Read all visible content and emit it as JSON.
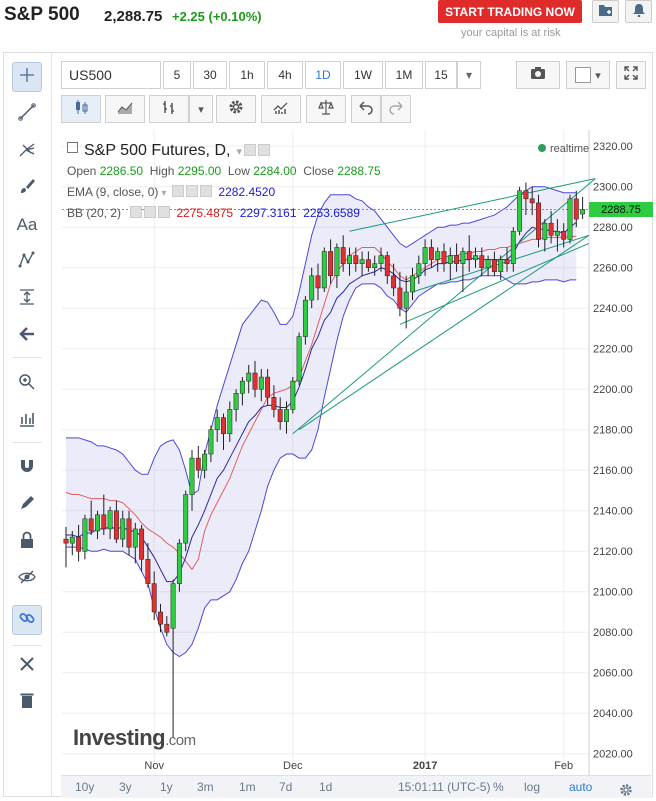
{
  "header": {
    "title": "S&P 500",
    "price": "2,288.75",
    "change": "+2.25 (+0.10%)",
    "start_button": "START TRADING NOW",
    "risk_note": "your capital is at risk"
  },
  "toolbar": {
    "symbol": "US500",
    "intervals": [
      "5",
      "30",
      "1h",
      "4h",
      "1D",
      "1W",
      "1M",
      "15"
    ],
    "selected_interval": "1D"
  },
  "legend": {
    "title": "S&P 500 Futures, D,",
    "realtime": "realtime",
    "ohlc_labels": {
      "open": "Open",
      "high": "High",
      "low": "Low",
      "close": "Close"
    },
    "ohlc_values": {
      "open": "2286.50",
      "high": "2295.00",
      "low": "2284.00",
      "close": "2288.75"
    },
    "ema_label": "EMA (9, close, 0)",
    "ema_value": "2282.4520",
    "bb_label": "BB (20, 2)",
    "bb_values": [
      "2275.4875",
      "2297.3161",
      "2253.6589"
    ]
  },
  "price_tag": "2288.75",
  "watermark": "Investing",
  "watermark_suffix": ".com",
  "bottom": {
    "ranges": [
      "10y",
      "3y",
      "1y",
      "3m",
      "1m",
      "7d",
      "1d"
    ],
    "time": "15:01:11 (UTC-5)",
    "pct": "%",
    "log": "log",
    "auto": "auto"
  },
  "colors": {
    "up": "#2ecc40",
    "down": "#e03030",
    "band": "#4a4ad8",
    "ema": "#2a2aa0",
    "mid": "#e06060",
    "trend": "#1a9a7a"
  },
  "chart_data": {
    "type": "candlestick",
    "title": "S&P 500 Futures, D",
    "y_ticks": [
      2020,
      2040,
      2060,
      2080,
      2100,
      2120,
      2140,
      2160,
      2180,
      2200,
      2220,
      2240,
      2260,
      2280,
      2300,
      2320
    ],
    "y_tick_labels": [
      "2020.00",
      "2040.00",
      "2060.00",
      "2080.00",
      "2100.00",
      "2120.00",
      "2140.00",
      "2160.00",
      "2180.00",
      "2200.00",
      "2220.00",
      "2240.00",
      "2260.00",
      "2280.00",
      "2300.00",
      "2320.00"
    ],
    "ylim": [
      2010,
      2328
    ],
    "x_ticks": [
      {
        "label": "Nov",
        "index": 14
      },
      {
        "label": "Dec",
        "index": 36
      },
      {
        "label": "2017",
        "index": 57
      },
      {
        "label": "Feb",
        "index": 79
      }
    ],
    "candles": [
      {
        "o": 2126,
        "h": 2132,
        "l": 2112,
        "c": 2124
      },
      {
        "o": 2124,
        "h": 2130,
        "l": 2118,
        "c": 2127
      },
      {
        "o": 2127,
        "h": 2133,
        "l": 2115,
        "c": 2120
      },
      {
        "o": 2120,
        "h": 2138,
        "l": 2116,
        "c": 2136
      },
      {
        "o": 2136,
        "h": 2145,
        "l": 2128,
        "c": 2130
      },
      {
        "o": 2130,
        "h": 2140,
        "l": 2126,
        "c": 2138
      },
      {
        "o": 2138,
        "h": 2148,
        "l": 2128,
        "c": 2131
      },
      {
        "o": 2131,
        "h": 2142,
        "l": 2126,
        "c": 2140
      },
      {
        "o": 2140,
        "h": 2145,
        "l": 2124,
        "c": 2126
      },
      {
        "o": 2126,
        "h": 2140,
        "l": 2122,
        "c": 2136
      },
      {
        "o": 2136,
        "h": 2140,
        "l": 2118,
        "c": 2122
      },
      {
        "o": 2122,
        "h": 2134,
        "l": 2114,
        "c": 2131
      },
      {
        "o": 2131,
        "h": 2133,
        "l": 2110,
        "c": 2116
      },
      {
        "o": 2116,
        "h": 2124,
        "l": 2102,
        "c": 2104
      },
      {
        "o": 2104,
        "h": 2110,
        "l": 2086,
        "c": 2090
      },
      {
        "o": 2090,
        "h": 2094,
        "l": 2080,
        "c": 2084
      },
      {
        "o": 2084,
        "h": 2088,
        "l": 2078,
        "c": 2080
      },
      {
        "o": 2082,
        "h": 2106,
        "l": 2028,
        "c": 2104
      },
      {
        "o": 2104,
        "h": 2126,
        "l": 2100,
        "c": 2124
      },
      {
        "o": 2124,
        "h": 2150,
        "l": 2120,
        "c": 2148
      },
      {
        "o": 2148,
        "h": 2170,
        "l": 2140,
        "c": 2166
      },
      {
        "o": 2166,
        "h": 2172,
        "l": 2156,
        "c": 2160
      },
      {
        "o": 2160,
        "h": 2170,
        "l": 2156,
        "c": 2168
      },
      {
        "o": 2168,
        "h": 2182,
        "l": 2164,
        "c": 2180
      },
      {
        "o": 2180,
        "h": 2190,
        "l": 2174,
        "c": 2186
      },
      {
        "o": 2186,
        "h": 2188,
        "l": 2170,
        "c": 2178
      },
      {
        "o": 2178,
        "h": 2194,
        "l": 2174,
        "c": 2190
      },
      {
        "o": 2190,
        "h": 2200,
        "l": 2184,
        "c": 2198
      },
      {
        "o": 2198,
        "h": 2206,
        "l": 2192,
        "c": 2204
      },
      {
        "o": 2204,
        "h": 2212,
        "l": 2198,
        "c": 2208
      },
      {
        "o": 2208,
        "h": 2214,
        "l": 2196,
        "c": 2200
      },
      {
        "o": 2200,
        "h": 2210,
        "l": 2194,
        "c": 2206
      },
      {
        "o": 2206,
        "h": 2210,
        "l": 2192,
        "c": 2196
      },
      {
        "o": 2196,
        "h": 2202,
        "l": 2186,
        "c": 2190
      },
      {
        "o": 2190,
        "h": 2196,
        "l": 2180,
        "c": 2184
      },
      {
        "o": 2184,
        "h": 2194,
        "l": 2178,
        "c": 2190
      },
      {
        "o": 2190,
        "h": 2206,
        "l": 2188,
        "c": 2204
      },
      {
        "o": 2204,
        "h": 2228,
        "l": 2202,
        "c": 2226
      },
      {
        "o": 2226,
        "h": 2246,
        "l": 2222,
        "c": 2244
      },
      {
        "o": 2244,
        "h": 2260,
        "l": 2240,
        "c": 2256
      },
      {
        "o": 2256,
        "h": 2262,
        "l": 2244,
        "c": 2250
      },
      {
        "o": 2250,
        "h": 2270,
        "l": 2248,
        "c": 2268
      },
      {
        "o": 2268,
        "h": 2274,
        "l": 2252,
        "c": 2256
      },
      {
        "o": 2256,
        "h": 2272,
        "l": 2250,
        "c": 2270
      },
      {
        "o": 2270,
        "h": 2276,
        "l": 2258,
        "c": 2262
      },
      {
        "o": 2262,
        "h": 2270,
        "l": 2256,
        "c": 2266
      },
      {
        "o": 2266,
        "h": 2270,
        "l": 2258,
        "c": 2262
      },
      {
        "o": 2262,
        "h": 2268,
        "l": 2256,
        "c": 2264
      },
      {
        "o": 2264,
        "h": 2268,
        "l": 2258,
        "c": 2260
      },
      {
        "o": 2260,
        "h": 2266,
        "l": 2256,
        "c": 2262
      },
      {
        "o": 2262,
        "h": 2270,
        "l": 2258,
        "c": 2266
      },
      {
        "o": 2266,
        "h": 2268,
        "l": 2252,
        "c": 2256
      },
      {
        "o": 2256,
        "h": 2262,
        "l": 2246,
        "c": 2250
      },
      {
        "o": 2250,
        "h": 2258,
        "l": 2236,
        "c": 2240
      },
      {
        "o": 2240,
        "h": 2256,
        "l": 2230,
        "c": 2248
      },
      {
        "o": 2248,
        "h": 2260,
        "l": 2244,
        "c": 2256
      },
      {
        "o": 2256,
        "h": 2266,
        "l": 2252,
        "c": 2262
      },
      {
        "o": 2262,
        "h": 2274,
        "l": 2256,
        "c": 2270
      },
      {
        "o": 2270,
        "h": 2274,
        "l": 2260,
        "c": 2264
      },
      {
        "o": 2264,
        "h": 2270,
        "l": 2258,
        "c": 2268
      },
      {
        "o": 2268,
        "h": 2272,
        "l": 2258,
        "c": 2262
      },
      {
        "o": 2262,
        "h": 2270,
        "l": 2254,
        "c": 2266
      },
      {
        "o": 2266,
        "h": 2272,
        "l": 2258,
        "c": 2262
      },
      {
        "o": 2262,
        "h": 2270,
        "l": 2248,
        "c": 2268
      },
      {
        "o": 2268,
        "h": 2276,
        "l": 2258,
        "c": 2264
      },
      {
        "o": 2264,
        "h": 2270,
        "l": 2260,
        "c": 2266
      },
      {
        "o": 2266,
        "h": 2270,
        "l": 2256,
        "c": 2260
      },
      {
        "o": 2260,
        "h": 2266,
        "l": 2256,
        "c": 2264
      },
      {
        "o": 2264,
        "h": 2268,
        "l": 2256,
        "c": 2258
      },
      {
        "o": 2258,
        "h": 2266,
        "l": 2254,
        "c": 2264
      },
      {
        "o": 2264,
        "h": 2270,
        "l": 2258,
        "c": 2262
      },
      {
        "o": 2262,
        "h": 2280,
        "l": 2258,
        "c": 2278
      },
      {
        "o": 2278,
        "h": 2300,
        "l": 2276,
        "c": 2298
      },
      {
        "o": 2298,
        "h": 2302,
        "l": 2286,
        "c": 2294
      },
      {
        "o": 2294,
        "h": 2300,
        "l": 2286,
        "c": 2292
      },
      {
        "o": 2292,
        "h": 2296,
        "l": 2270,
        "c": 2274
      },
      {
        "o": 2274,
        "h": 2284,
        "l": 2268,
        "c": 2282
      },
      {
        "o": 2282,
        "h": 2288,
        "l": 2272,
        "c": 2276
      },
      {
        "o": 2276,
        "h": 2284,
        "l": 2268,
        "c": 2278
      },
      {
        "o": 2278,
        "h": 2282,
        "l": 2270,
        "c": 2274
      },
      {
        "o": 2274,
        "h": 2296,
        "l": 2272,
        "c": 2294
      },
      {
        "o": 2294,
        "h": 2298,
        "l": 2280,
        "c": 2284
      },
      {
        "o": 2286.5,
        "h": 2295,
        "l": 2284,
        "c": 2288.75
      }
    ],
    "bb_upper": [
      2176,
      2176,
      2176,
      2175,
      2174,
      2172,
      2172,
      2171,
      2170,
      2168,
      2164,
      2160,
      2158,
      2158,
      2166,
      2172,
      2174,
      2175,
      2170,
      2160,
      2148,
      2150,
      2168,
      2180,
      2192,
      2202,
      2212,
      2222,
      2232,
      2236,
      2240,
      2244,
      2243,
      2238,
      2232,
      2232,
      2236,
      2248,
      2262,
      2276,
      2286,
      2292,
      2296,
      2296,
      2296,
      2296,
      2294,
      2293,
      2290,
      2288,
      2284,
      2280,
      2276,
      2272,
      2270,
      2272,
      2274,
      2276,
      2278,
      2280,
      2280,
      2281,
      2281,
      2282,
      2282,
      2283,
      2284,
      2285,
      2286,
      2288,
      2290,
      2293,
      2296,
      2298,
      2300,
      2300,
      2300,
      2299,
      2298,
      2297,
      2297,
      2297
    ],
    "bb_lower": [
      2122,
      2122,
      2122,
      2121,
      2120,
      2120,
      2121,
      2120,
      2120,
      2120,
      2118,
      2116,
      2110,
      2104,
      2092,
      2082,
      2074,
      2070,
      2068,
      2070,
      2074,
      2082,
      2092,
      2096,
      2096,
      2098,
      2100,
      2106,
      2114,
      2120,
      2130,
      2140,
      2152,
      2160,
      2166,
      2168,
      2168,
      2166,
      2166,
      2170,
      2180,
      2196,
      2210,
      2224,
      2236,
      2244,
      2250,
      2252,
      2252,
      2252,
      2250,
      2246,
      2244,
      2240,
      2238,
      2242,
      2246,
      2248,
      2250,
      2252,
      2252,
      2253,
      2253,
      2254,
      2254,
      2255,
      2256,
      2256,
      2256,
      2256,
      2254,
      2252,
      2252,
      2252,
      2253,
      2253,
      2254,
      2254,
      2254,
      2253,
      2254,
      2254
    ],
    "bb_middle": [
      2149,
      2148,
      2148,
      2147,
      2146,
      2146,
      2146,
      2145,
      2145,
      2144,
      2141,
      2138,
      2134,
      2131,
      2129,
      2127,
      2124,
      2122,
      2119,
      2115,
      2111,
      2116,
      2130,
      2138,
      2144,
      2150,
      2156,
      2164,
      2172,
      2178,
      2184,
      2190,
      2196,
      2198,
      2199,
      2200,
      2202,
      2206,
      2214,
      2222,
      2232,
      2242,
      2252,
      2258,
      2262,
      2266,
      2268,
      2270,
      2270,
      2270,
      2267,
      2263,
      2260,
      2256,
      2254,
      2256,
      2258,
      2260,
      2262,
      2264,
      2265,
      2266,
      2266,
      2267,
      2267,
      2268,
      2268,
      2269,
      2269,
      2270,
      2270,
      2271,
      2272,
      2273,
      2274,
      2274,
      2275,
      2275,
      2275,
      2275,
      2275.4875,
      2275.4875
    ],
    "ema": [
      2128,
      2128,
      2127,
      2129,
      2129,
      2131,
      2131,
      2132,
      2131,
      2132,
      2130,
      2130,
      2127,
      2122,
      2117,
      2111,
      2105,
      2105,
      2109,
      2117,
      2127,
      2133,
      2140,
      2148,
      2156,
      2160,
      2166,
      2172,
      2178,
      2184,
      2187,
      2191,
      2192,
      2192,
      2191,
      2191,
      2194,
      2201,
      2210,
      2220,
      2226,
      2234,
      2238,
      2245,
      2248,
      2252,
      2254,
      2256,
      2257,
      2258,
      2260,
      2259,
      2257,
      2254,
      2253,
      2254,
      2256,
      2259,
      2260,
      2262,
      2262,
      2263,
      2263,
      2264,
      2264,
      2265,
      2264,
      2264,
      2264,
      2264,
      2264,
      2267,
      2273,
      2277,
      2280,
      2279,
      2279,
      2278,
      2278,
      2277,
      2280,
      2282.452
    ],
    "trendlines": [
      {
        "from": {
          "index": 36,
          "value": 2178
        },
        "to": {
          "index": 84,
          "value": 2304
        }
      },
      {
        "from": {
          "index": 45,
          "value": 2278
        },
        "to": {
          "index": 84,
          "value": 2304
        }
      },
      {
        "from": {
          "index": 37,
          "value": 2180
        },
        "to": {
          "index": 83,
          "value": 2276
        }
      },
      {
        "from": {
          "index": 53,
          "value": 2232
        },
        "to": {
          "index": 83,
          "value": 2272
        }
      },
      {
        "from": {
          "index": 55,
          "value": 2248
        },
        "to": {
          "index": 83,
          "value": 2276
        }
      }
    ]
  }
}
